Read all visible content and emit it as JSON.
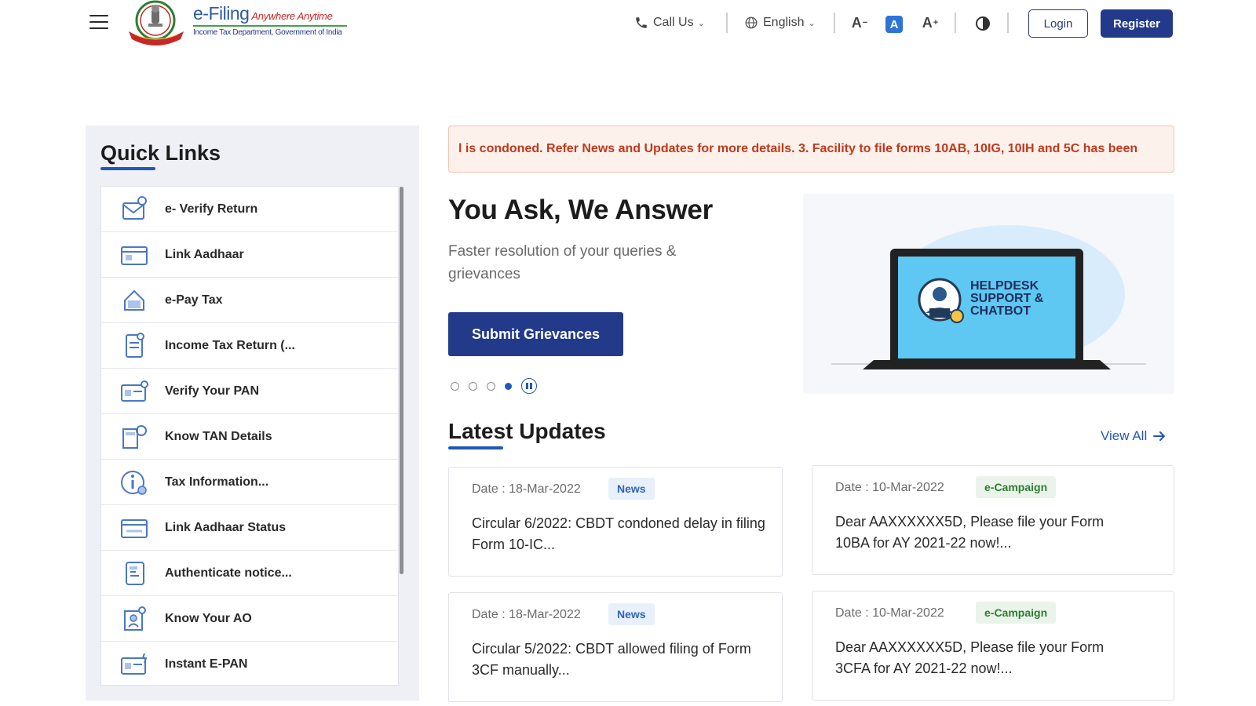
{
  "header": {
    "logo": {
      "name": "e-Filing",
      "tagline": "Anywhere Anytime",
      "subtitle": "Income Tax Department, Government of India"
    },
    "call_us": "Call Us",
    "language": "English",
    "font_decrease": "A",
    "font_default": "A",
    "font_increase": "A",
    "login": "Login",
    "register": "Register"
  },
  "quick_links": {
    "title": "Quick Links",
    "items": [
      {
        "label": "e- Verify Return",
        "icon": "verify-return-icon"
      },
      {
        "label": "Link Aadhaar",
        "icon": "aadhaar-card-icon"
      },
      {
        "label": "e-Pay Tax",
        "icon": "pay-tax-icon"
      },
      {
        "label": "Income Tax Return (...",
        "icon": "tax-return-icon"
      },
      {
        "label": "Verify Your PAN",
        "icon": "pan-card-icon"
      },
      {
        "label": "Know TAN Details",
        "icon": "tan-details-icon"
      },
      {
        "label": "Tax Information...",
        "icon": "info-icon"
      },
      {
        "label": "Link Aadhaar Status",
        "icon": "aadhaar-status-icon"
      },
      {
        "label": "Authenticate notice...",
        "icon": "notice-icon"
      },
      {
        "label": "Know Your AO",
        "icon": "officer-icon"
      },
      {
        "label": "Instant E-PAN",
        "icon": "epan-icon"
      }
    ]
  },
  "ticker": {
    "text": "l is condoned. Refer News and Updates for more details. 3. Facility to file forms 10AB, 10IG, 10IH and 5C has been"
  },
  "hero": {
    "title": "You Ask, We Answer",
    "subtitle": "Faster resolution of your queries & grievances",
    "button": "Submit Grievances",
    "image_text": [
      "HELPDESK",
      "SUPPORT &",
      "CHATBOT"
    ],
    "slides": 4,
    "active_slide": 4
  },
  "latest_updates": {
    "title": "Latest Updates",
    "view_all": "View All",
    "cards": [
      {
        "date": "Date : 18-Mar-2022",
        "badge": "News",
        "type": "news",
        "text": "Circular 6/2022: CBDT condoned delay in filing Form 10-IC..."
      },
      {
        "date": "Date : 10-Mar-2022",
        "badge": "e-Campaign",
        "type": "camp",
        "text": "Dear AAXXXXXX5D, Please file your Form 10BA for AY 2021-22 now!..."
      },
      {
        "date": "Date : 18-Mar-2022",
        "badge": "News",
        "type": "news",
        "text": "Circular 5/2022: CBDT allowed filing of Form 3CF manually..."
      },
      {
        "date": "Date : 10-Mar-2022",
        "badge": "e-Campaign",
        "type": "camp",
        "text": "Dear AAXXXXXX5D, Please file your Form 3CFA for AY 2021-22 now!..."
      }
    ]
  },
  "colors": {
    "primary": "#233a8a",
    "accent": "#2158b8",
    "ticker_text": "#c0391b",
    "news_badge": "#2f64b8",
    "campaign_badge": "#2e7d32"
  }
}
